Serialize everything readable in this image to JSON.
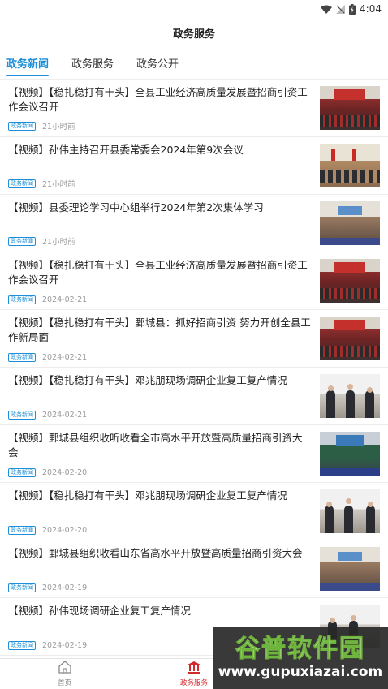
{
  "status_bar": {
    "time": "4:04",
    "icons": [
      "wifi-icon",
      "signal-off-icon",
      "battery-icon"
    ]
  },
  "header": {
    "title": "政务服务"
  },
  "tabs": [
    {
      "label": "政务新闻",
      "active": true
    },
    {
      "label": "政务服务",
      "active": false
    },
    {
      "label": "政务公开",
      "active": false
    }
  ],
  "news": [
    {
      "title": "【视频】【稳扎稳打有干头】全县工业经济高质量发展暨招商引资工作会议召开",
      "tag": "政务新闻",
      "time": "21小时前",
      "thumb": "meeting"
    },
    {
      "title": "【视频】孙伟主持召开县委常委会2024年第9次会议",
      "tag": "政务新闻",
      "time": "21小时前",
      "thumb": "room"
    },
    {
      "title": "【视频】县委理论学习中心组举行2024年第2次集体学习",
      "tag": "政务新闻",
      "time": "21小时前",
      "thumb": "hall"
    },
    {
      "title": "【视频】【稳扎稳打有干头】全县工业经济高质量发展暨招商引资工作会议召开",
      "tag": "政务新闻",
      "time": "2024-02-21",
      "thumb": "meeting"
    },
    {
      "title": "【视频】【稳扎稳打有干头】鄄城县：抓好招商引资  努力开创全县工作新局面",
      "tag": "政务新闻",
      "time": "2024-02-21",
      "thumb": "meeting"
    },
    {
      "title": "【视频】【稳扎稳打有干头】邓兆朋现场调研企业复工复产情况",
      "tag": "政务新闻",
      "time": "2024-02-21",
      "thumb": "outdoor"
    },
    {
      "title": "【视频】鄄城县组织收听收看全市高水平开放暨高质量招商引资大会",
      "tag": "政务新闻",
      "time": "2024-02-20",
      "thumb": "conf"
    },
    {
      "title": "【视频】【稳扎稳打有干头】邓兆朋现场调研企业复工复产情况",
      "tag": "政务新闻",
      "time": "2024-02-20",
      "thumb": "outdoor"
    },
    {
      "title": "【视频】鄄城县组织收看山东省高水平开放暨高质量招商引资大会",
      "tag": "政务新闻",
      "time": "2024-02-19",
      "thumb": "hall"
    },
    {
      "title": "【视频】孙伟现场调研企业复工复产情况",
      "tag": "政务新闻",
      "time": "2024-02-19",
      "thumb": "outdoor"
    }
  ],
  "bottom_nav": [
    {
      "label": "首页",
      "icon": "home-icon",
      "active": false
    },
    {
      "label": "政务服务",
      "icon": "government-building-icon",
      "active": true
    }
  ],
  "watermark": {
    "title": "谷普软件园",
    "url": "www.gupuxiazai.com"
  },
  "colors": {
    "tab_active": "#1d8fd8",
    "nav_active": "#d4282a",
    "tag": "#1d8fd8",
    "time": "#9a9a9a"
  }
}
